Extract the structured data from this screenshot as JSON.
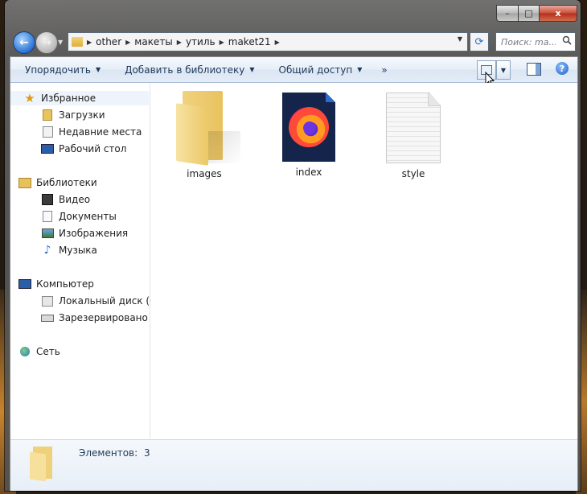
{
  "window": {
    "caption_buttons": {
      "minimize": "–",
      "maximize": "□",
      "close": "x"
    }
  },
  "navigation": {
    "back_icon": "←",
    "forward_icon": "→",
    "dropdown_icon": "▼"
  },
  "address": {
    "breadcrumbs": [
      "other",
      "макеты",
      "утиль",
      "maket21"
    ],
    "separator": "▶",
    "dropdown_icon": "▼",
    "refresh_icon": "⟳"
  },
  "search": {
    "placeholder": "Поиск: ma..."
  },
  "toolbar": {
    "organize": "Упорядочить",
    "add_to_library": "Добавить в библиотеку",
    "share": "Общий доступ",
    "more": "»",
    "dropdown_icon": "▼",
    "help": "?"
  },
  "sidebar": {
    "favorites": {
      "label": "Избранное",
      "items": [
        {
          "label": "Загрузки",
          "icon": "downloads-icon"
        },
        {
          "label": "Недавние места",
          "icon": "recent-places-icon"
        },
        {
          "label": "Рабочий стол",
          "icon": "desktop-icon"
        }
      ]
    },
    "libraries": {
      "label": "Библиотеки",
      "items": [
        {
          "label": "Видео",
          "icon": "video-icon"
        },
        {
          "label": "Документы",
          "icon": "documents-icon"
        },
        {
          "label": "Изображения",
          "icon": "pictures-icon"
        },
        {
          "label": "Музыка",
          "icon": "music-icon"
        }
      ]
    },
    "computer": {
      "label": "Компьютер",
      "items": [
        {
          "label": "Локальный диск (C:)",
          "icon": "drive-icon"
        },
        {
          "label": "Зарезервировано системой",
          "icon": "reserved-drive-icon"
        }
      ]
    },
    "network": {
      "label": "Сеть"
    }
  },
  "files": [
    {
      "name": "images",
      "type": "folder"
    },
    {
      "name": "index",
      "type": "firefox-html"
    },
    {
      "name": "style",
      "type": "text"
    }
  ],
  "details": {
    "label": "Элементов:",
    "count": "3"
  },
  "colors": {
    "accent": "#1e395b",
    "selection": "#eef4fb",
    "close_button": "#c94d38"
  }
}
